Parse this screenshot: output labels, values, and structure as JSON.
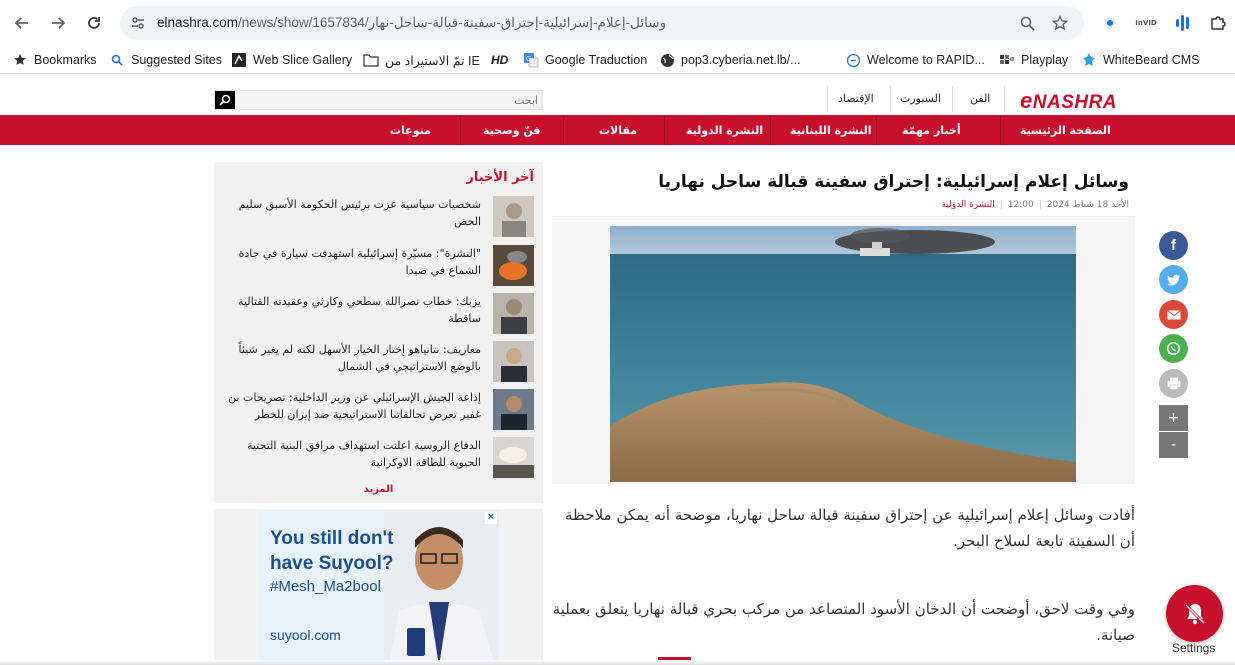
{
  "browser": {
    "url_host": "elnashra.com",
    "url_path": "/news/show/1657834/وسائل-إعلام-إسرائيلية-إحتراق-سفينة-قبالة-ساحل-نهار",
    "ext_invid": "InVID",
    "bookmarks": [
      {
        "label": "Bookmarks",
        "icon": "star-icon"
      },
      {
        "label": "Suggested Sites",
        "icon": "search-icon"
      },
      {
        "label": "Web Slice Gallery",
        "icon": "web-slice-icon"
      },
      {
        "label": "تمّ الاستيراد من IE",
        "icon": "folder-icon"
      },
      {
        "label": "HD",
        "icon": "hd-icon"
      },
      {
        "label": "Google Traduction",
        "icon": "translate-icon"
      },
      {
        "label": "pop3.cyberia.net.lb/...",
        "icon": "globe-icon"
      },
      {
        "label": "Welcome to RAPID...",
        "icon": "rapid-icon"
      },
      {
        "label": "Playplay",
        "icon": "playplay-icon"
      },
      {
        "label": "WhiteBeard CMS",
        "icon": "whitebeard-icon"
      }
    ]
  },
  "site": {
    "logo": "NASHRA",
    "logo_e": "e",
    "top_links": [
      "الفن",
      "السبورت",
      "الإقتصاد"
    ],
    "search_placeholder": "ابحث",
    "nav": [
      "الصفحة الرئيسية",
      "أخبار مهمّة",
      "النشرة اللبنانية",
      "النشرة الدولية",
      "مقالات",
      "فنّ وصحية",
      "منوعات"
    ],
    "brand_color": "#c8102e"
  },
  "article": {
    "title": "وسائل إعلام إسرائيلية: إحتراق سفينة قبالة ساحل نهاريا",
    "date": "الأحد 18 شباط 2024",
    "time": "12:00",
    "category": "النشرة الدولية",
    "paragraphs": [
      "أفادت وسائل إعلام إسرائيلية عن إحتراق سفينة قبالة ساحل نهاريا، موضحة أنه يمكن ملاحظة أن السفينة تابعة لسلاح البحر.",
      "وفي وقت لاحق، أوضحت أن الدخان الأسود المتصاعد من مركب بحري قبالة نهاريا يتعلق بعملية صيانة."
    ]
  },
  "sidebar": {
    "title": "آخر الأخبار",
    "items": [
      "شخصيات سياسية عزت برئيس الحكومة الأسبق سليم الحص",
      "\"النشرة\": مسيّرة إسرائيلية استهدفت سيارة في جادة الشماع في صيدا",
      "يزبك: خطاب نصرالله سطحي وكارثي وعقيدته القتالية ساقطة",
      "معاريف: نتانياهو إختار الخيار الأسهل لكنه لم يغير شيئاً بالوضع الاستراتيجي في الشمال",
      "إذاعة الجيش الإسرائيلي عن وزير الداخلية: تصريحات بن غفير تعرض تحالفاتنا الاستراتيجية ضد إيران للخطر",
      "الدفاع الروسية اعلنت استهداف مرافق البنية التحتية الحيوية للطاقة الاوكرانية"
    ],
    "more": "المزيد"
  },
  "ad": {
    "headline_1": "You still don't",
    "headline_2": "have Suyool?",
    "hashtag": "#Mesh_Ma2bool",
    "url": "suyool.com",
    "close": "✕"
  },
  "share": {
    "zoom_in": "+",
    "zoom_out": "-"
  },
  "notification": {
    "label": "Settings"
  }
}
